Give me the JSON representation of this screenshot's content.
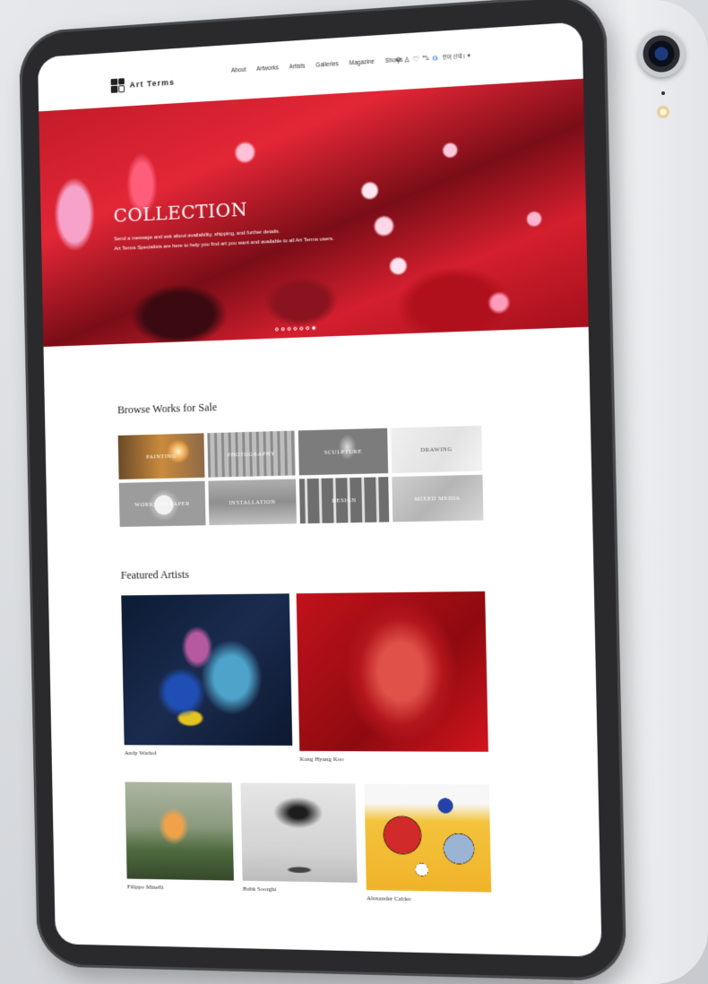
{
  "header": {
    "logo_text": "Art Terms",
    "nav": [
      "About",
      "Artworks",
      "Artists",
      "Galleries",
      "Magazine",
      "Shows"
    ],
    "lang_label": "언어 선택 | ▼"
  },
  "hero": {
    "title": "COLLECTION",
    "subtitle_line1": "Send a message and ask about availability, shipping, and further details.",
    "subtitle_line2": "Art Terms Specialists are here to help you find art you want and available to all Art Terms users.",
    "slide_count": 7,
    "active_slide": 7
  },
  "browse": {
    "title": "Browse Works for Sale",
    "categories": [
      "PAINTING",
      "PHOTOGRAPHY",
      "SCULPTURE",
      "DRAWING",
      "WORKS ON PAPER",
      "INSTALLATION",
      "DESIGN",
      "MIXED MEDIA"
    ]
  },
  "featured": {
    "title": "Featured Artists",
    "artists": [
      "Andy Warhol",
      "Kang Hyung Koo",
      "Filippo Minelli",
      "Babk Soorghi",
      "Alexander Calder"
    ]
  },
  "icons": [
    "search-icon",
    "user-icon",
    "heart-icon",
    "cart-icon",
    "google-icon"
  ]
}
